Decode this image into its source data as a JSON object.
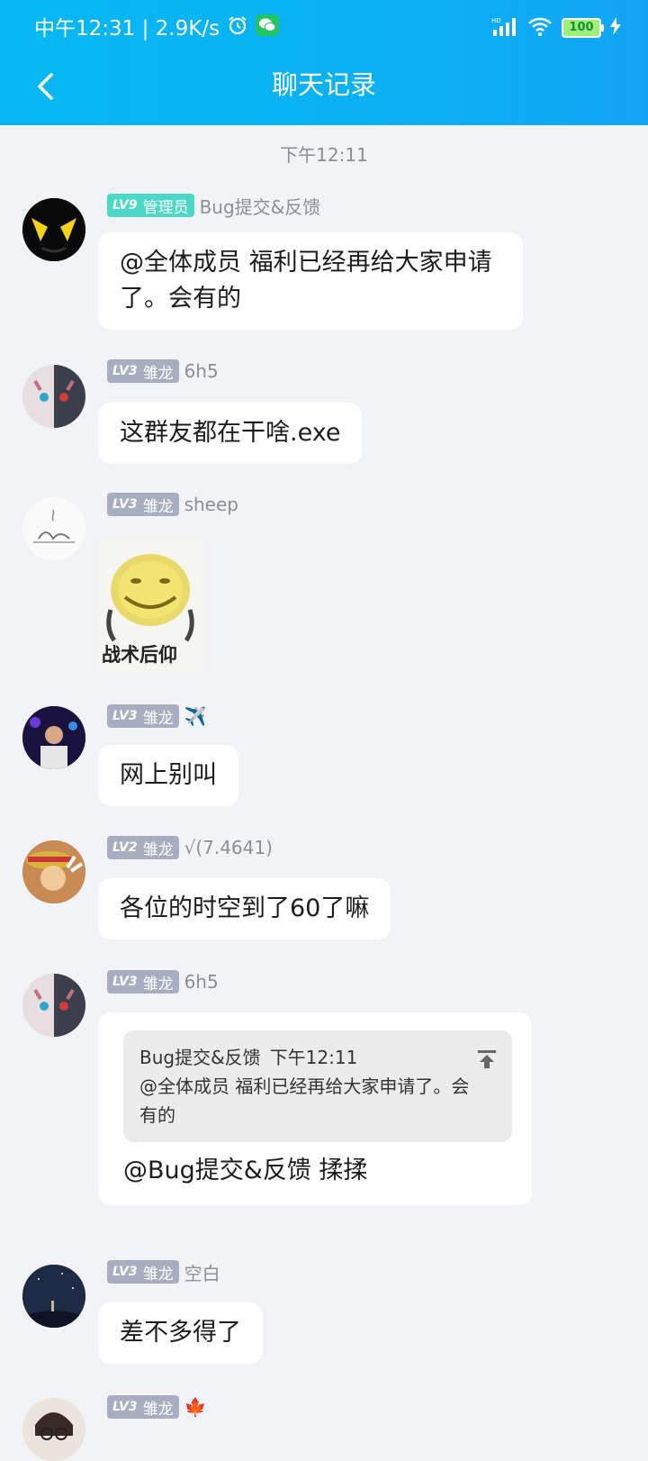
{
  "status": {
    "time_text": "中午12:31 | 2.9K/s",
    "battery": "100"
  },
  "header": {
    "title": "聊天记录"
  },
  "time_separator": "下午12:11",
  "messages": [
    {
      "level": "LV9",
      "role": "管理员",
      "nick": "Bug提交&反馈",
      "text": "@全体成员 福利已经再给大家申请了。会有的"
    },
    {
      "level": "LV3",
      "role": "雏龙",
      "nick": "6h5",
      "text": "这群友都在干啥.exe"
    },
    {
      "level": "LV3",
      "role": "雏龙",
      "nick": "sheep",
      "sticker_caption": "战术后仰"
    },
    {
      "level": "LV3",
      "role": "雏龙",
      "nick": "✈️",
      "text": "网上别叫"
    },
    {
      "level": "LV2",
      "role": "雏龙",
      "nick": "√(7.4641)",
      "text": "各位的时空到了60了嘛"
    },
    {
      "level": "LV3",
      "role": "雏龙",
      "nick": "6h5",
      "quote": {
        "author": "Bug提交&反馈",
        "time": "下午12:11",
        "text": "@全体成员 福利已经再给大家申请了。会有的"
      },
      "text": "@Bug提交&反馈 揉揉"
    },
    {
      "level": "LV3",
      "role": "雏龙",
      "nick": "空白",
      "text": "差不多得了"
    },
    {
      "level": "LV3",
      "role": "雏龙",
      "nick": "🍁"
    }
  ],
  "colors": {
    "header": "#0ab2f3",
    "admin_badge": "#4bd8c6",
    "level_badge": "#a6aebf",
    "background": "#f2f3f7"
  }
}
